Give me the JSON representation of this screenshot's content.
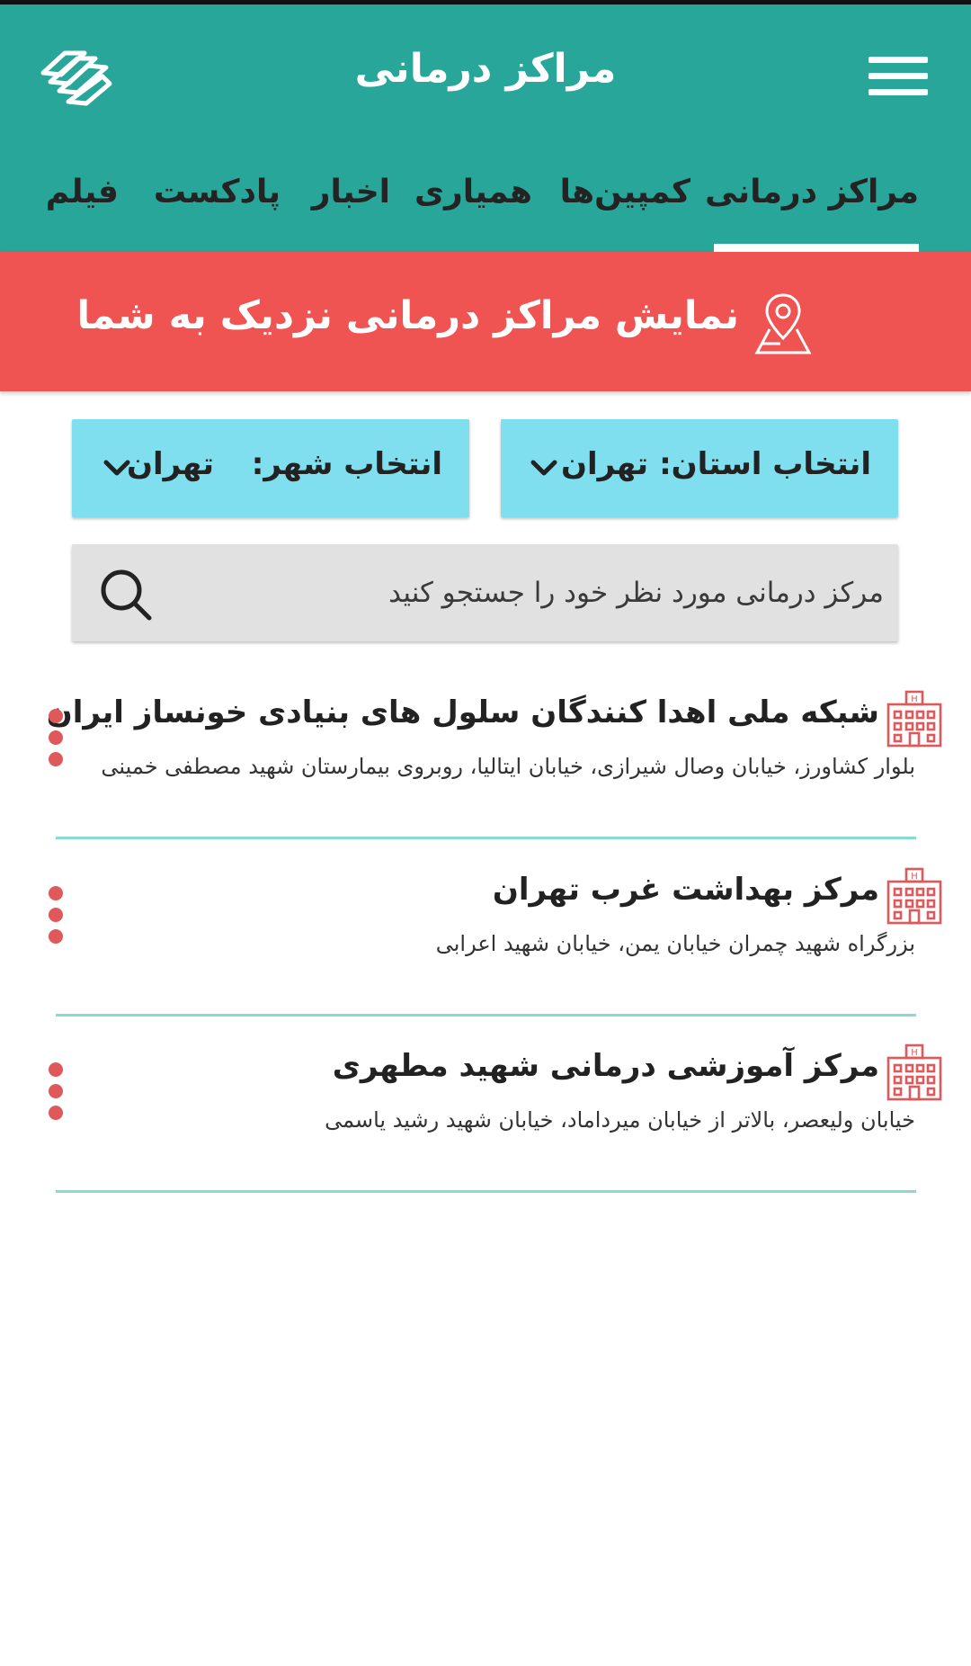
{
  "app": {
    "title": "مراکز درمانی"
  },
  "tabs": [
    {
      "label": "مراکز درمانی",
      "active": true
    },
    {
      "label": "کمپین‌ها"
    },
    {
      "label": "همیاری"
    },
    {
      "label": "اخبار"
    },
    {
      "label": "پادکست"
    },
    {
      "label": "فیلم"
    }
  ],
  "banner": {
    "text": "نمایش مراکز درمانی نزدیک به شما",
    "icon": "map-pin-icon"
  },
  "filters": {
    "province": {
      "label": "انتخاب استان:",
      "value": "تهران"
    },
    "city": {
      "label": "انتخاب شهر:",
      "value": "تهران"
    }
  },
  "search": {
    "placeholder": "مرکز درمانی مورد نظر خود را جستجو کنید"
  },
  "centers": [
    {
      "name": "شبکه ملی اهدا کنندگان سلول های بنیادی خونساز ایران",
      "address": "بلوار کشاورز، خیابان وصال شیرازی، خیابان ایتالیا، روبروی بیمارستان شهید مصطفی خمینی"
    },
    {
      "name": "مرکز بهداشت غرب تهران",
      "address": "بزرگراه شهید چمران خیابان یمن، خیابان شهید اعرابی"
    },
    {
      "name": "مرکز آموزشی درمانی شهید مطهری",
      "address": "خیابان ولیعصر، بالاتر از خیابان میرداماد، خیابان شهید رشید یاسمی"
    }
  ],
  "colors": {
    "primary": "#28a69a",
    "banner": "#ef5452",
    "select": "#7fdfee",
    "search": "#e1e1e1",
    "accent": "#e0595a",
    "divider": "#8ad9d3"
  }
}
